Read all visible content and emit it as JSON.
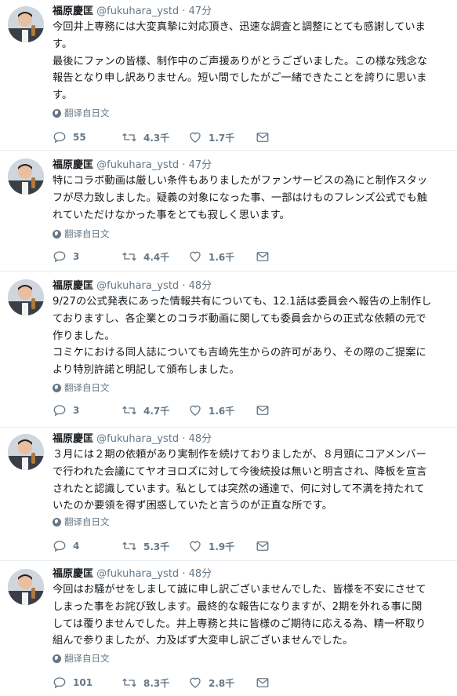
{
  "tweets": [
    {
      "name": "福原慶匡",
      "handle": "@fukuhara_ystd",
      "time": "47分",
      "lines": [
        "今回井上専務には大変真摯に対応頂き、迅速な調査と調整にとても感謝していま",
        "す。",
        "最後にファンの皆様、制作中のご声援ありがとうございました。この様な残念な",
        "報告となり申し訳ありません。短い間でしたがご一緒できたことを誇りに思いま",
        "す。"
      ],
      "translate": "翻译自日文",
      "replies": "55",
      "retweets": "4.3千",
      "likes": "1.7千"
    },
    {
      "name": "福原慶匡",
      "handle": "@fukuhara_ystd",
      "time": "47分",
      "lines": [
        "特にコラボ動画は厳しい条件もありましたがファンサービスの為にと制作スタッ",
        "フが尽力致しました。疑義の対象になった事、一部はけものフレンズ公式でも触",
        "れていただけなかった事をとても寂しく思います。"
      ],
      "translate": "翻译自日文",
      "replies": "3",
      "retweets": "4.4千",
      "likes": "1.6千"
    },
    {
      "name": "福原慶匡",
      "handle": "@fukuhara_ystd",
      "time": "48分",
      "lines": [
        "9/27の公式発表にあった情報共有についても、12.1話は委員会へ報告の上制作し",
        "ておりますし、各企業とのコラボ動画に関しても委員会からの正式な依頼の元で",
        "作りました。",
        "コミケにおける同人誌についても吉崎先生からの許可があり、その際のご提案に",
        "より特別許諾と明記して頒布しました。"
      ],
      "translate": "翻译自日文",
      "replies": "3",
      "retweets": "4.7千",
      "likes": "1.6千"
    },
    {
      "name": "福原慶匡",
      "handle": "@fukuhara_ystd",
      "time": "48分",
      "lines": [
        "３月には２期の依頼があり実制作を続けておりましたが、８月頭にコアメンバー",
        "で行われた会議にてヤオヨロズに対して今後続投は無いと明言され、降板を宣言",
        "されたと認識しています。私としては突然の通達で、何に対して不満を持たれて",
        "いたのか要領を得ず困惑していたと言うのが正直な所です。"
      ],
      "translate": "翻译自日文",
      "replies": "4",
      "retweets": "5.3千",
      "likes": "1.9千"
    },
    {
      "name": "福原慶匡",
      "handle": "@fukuhara_ystd",
      "time": "48分",
      "lines": [
        "今回はお騒がせをしまして誠に申し訳ございませんでした、皆様を不安にさせて",
        "しまった事をお詫び致します。最終的な報告になりますが、2期を外れる事に関",
        "しては覆りませんでした。井上専務と共に皆様のご期待に応える為、精一杯取り",
        "組んで参りましたが、力及ばず大変申し訳ございませんでした。"
      ],
      "translate": "翻译自日文",
      "replies": "101",
      "retweets": "8.3千",
      "likes": "2.8千"
    }
  ]
}
